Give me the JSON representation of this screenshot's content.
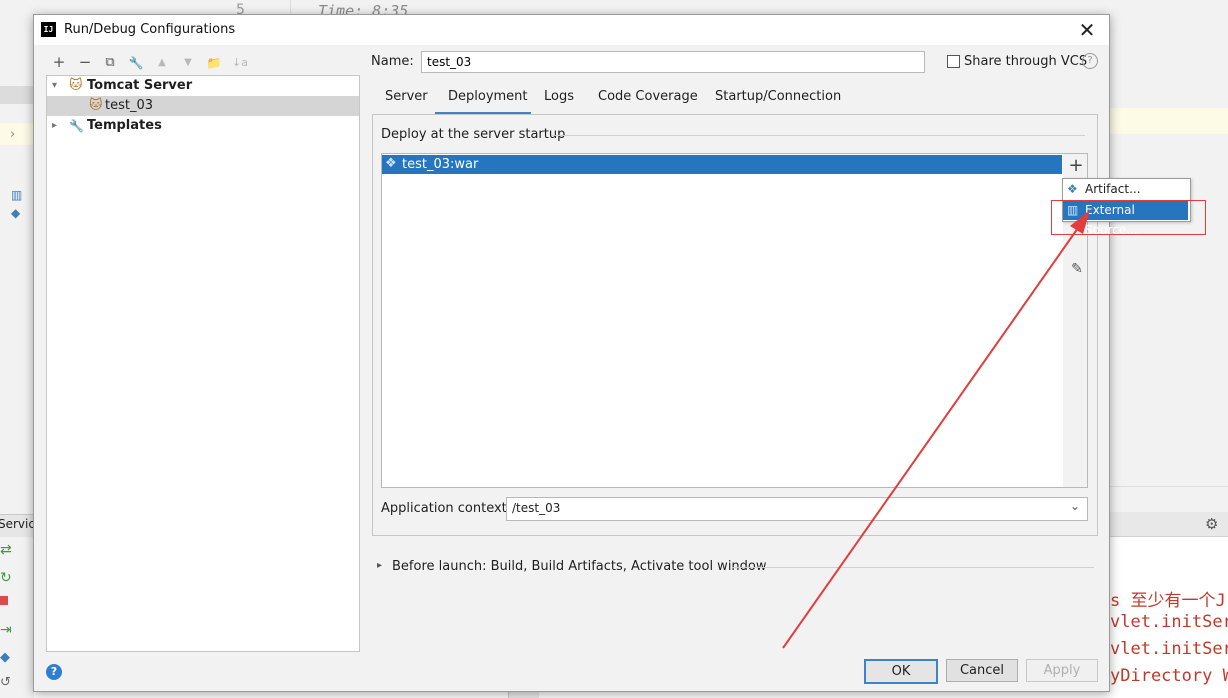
{
  "background_ide": {
    "top_line_number": "5",
    "top_code": "Time: 8:35",
    "services_label": "Service",
    "console_lines": [
      "s 至少有一个J",
      "vlet.initSer",
      "vlet.initSer",
      "yDirectory W"
    ]
  },
  "dialog": {
    "app_logo_text": "IJ",
    "title": "Run/Debug Configurations",
    "close_glyph": "✕"
  },
  "toolbar": {
    "add": "+",
    "remove": "−",
    "copy": "⧉",
    "edit_defaults": "🔧",
    "move_up": "▲",
    "move_down": "▼",
    "new_folder": "📁",
    "sort": "↓a"
  },
  "tree": {
    "tomcat_server": {
      "arrow": "▾",
      "label": "Tomcat Server"
    },
    "test_03": {
      "label": "test_03"
    },
    "templates": {
      "arrow": "▸",
      "label": "Templates"
    }
  },
  "name_field": {
    "label": "Name:",
    "value": "test_03"
  },
  "share": {
    "label": "Share through VCS",
    "checked": false,
    "help": "?"
  },
  "tabs": [
    {
      "label": "Server",
      "active": false
    },
    {
      "label": "Deployment",
      "active": true
    },
    {
      "label": "Logs",
      "active": false
    },
    {
      "label": "Code Coverage",
      "active": false
    },
    {
      "label": "Startup/Connection",
      "active": false
    }
  ],
  "deploy": {
    "header": "Deploy at the server startup",
    "artifacts": [
      "test_03:war"
    ],
    "add_glyph": "+",
    "edit_glyph": "✎"
  },
  "popup_menu": {
    "items": [
      {
        "label": "Artifact...",
        "icon": "artifact-icon",
        "selected": false
      },
      {
        "label": "External Source...",
        "icon": "external-source-icon",
        "selected": true
      }
    ]
  },
  "app_context": {
    "label": "Application context:",
    "value": "/test_03"
  },
  "before_launch": {
    "arrow": "▸",
    "label": "Before launch: Build, Build Artifacts, Activate tool window"
  },
  "buttons": {
    "ok": "OK",
    "cancel": "Cancel",
    "apply": "Apply",
    "help": "?"
  },
  "colors": {
    "selection_blue": "#2675bf",
    "tab_underline": "#4083c9",
    "annotation_red": "#e23c3c"
  }
}
